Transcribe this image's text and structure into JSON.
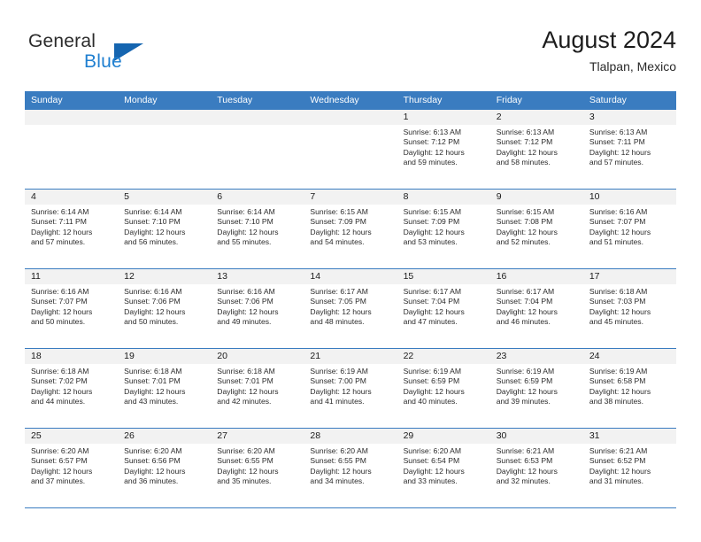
{
  "brand": {
    "name_part1": "General",
    "name_part2": "Blue",
    "flag_icon": "triangle-flag-icon",
    "accent_color": "#1f7fd0",
    "flag_color": "#1565b0"
  },
  "header": {
    "title": "August 2024",
    "subtitle": "Tlalpan, Mexico",
    "header_bg_color": "#3a7cc0",
    "date_strip_color": "#f2f2f2"
  },
  "weekdays": [
    "Sunday",
    "Monday",
    "Tuesday",
    "Wednesday",
    "Thursday",
    "Friday",
    "Saturday"
  ],
  "weeks": [
    [
      {
        "day": "",
        "sunrise": "",
        "sunset": "",
        "daylight_line1": "",
        "daylight_line2": "",
        "empty": true
      },
      {
        "day": "",
        "sunrise": "",
        "sunset": "",
        "daylight_line1": "",
        "daylight_line2": "",
        "empty": true
      },
      {
        "day": "",
        "sunrise": "",
        "sunset": "",
        "daylight_line1": "",
        "daylight_line2": "",
        "empty": true
      },
      {
        "day": "",
        "sunrise": "",
        "sunset": "",
        "daylight_line1": "",
        "daylight_line2": "",
        "empty": true
      },
      {
        "day": "1",
        "sunrise": "Sunrise: 6:13 AM",
        "sunset": "Sunset: 7:12 PM",
        "daylight_line1": "Daylight: 12 hours",
        "daylight_line2": "and 59 minutes."
      },
      {
        "day": "2",
        "sunrise": "Sunrise: 6:13 AM",
        "sunset": "Sunset: 7:12 PM",
        "daylight_line1": "Daylight: 12 hours",
        "daylight_line2": "and 58 minutes."
      },
      {
        "day": "3",
        "sunrise": "Sunrise: 6:13 AM",
        "sunset": "Sunset: 7:11 PM",
        "daylight_line1": "Daylight: 12 hours",
        "daylight_line2": "and 57 minutes."
      }
    ],
    [
      {
        "day": "4",
        "sunrise": "Sunrise: 6:14 AM",
        "sunset": "Sunset: 7:11 PM",
        "daylight_line1": "Daylight: 12 hours",
        "daylight_line2": "and 57 minutes."
      },
      {
        "day": "5",
        "sunrise": "Sunrise: 6:14 AM",
        "sunset": "Sunset: 7:10 PM",
        "daylight_line1": "Daylight: 12 hours",
        "daylight_line2": "and 56 minutes."
      },
      {
        "day": "6",
        "sunrise": "Sunrise: 6:14 AM",
        "sunset": "Sunset: 7:10 PM",
        "daylight_line1": "Daylight: 12 hours",
        "daylight_line2": "and 55 minutes."
      },
      {
        "day": "7",
        "sunrise": "Sunrise: 6:15 AM",
        "sunset": "Sunset: 7:09 PM",
        "daylight_line1": "Daylight: 12 hours",
        "daylight_line2": "and 54 minutes."
      },
      {
        "day": "8",
        "sunrise": "Sunrise: 6:15 AM",
        "sunset": "Sunset: 7:09 PM",
        "daylight_line1": "Daylight: 12 hours",
        "daylight_line2": "and 53 minutes."
      },
      {
        "day": "9",
        "sunrise": "Sunrise: 6:15 AM",
        "sunset": "Sunset: 7:08 PM",
        "daylight_line1": "Daylight: 12 hours",
        "daylight_line2": "and 52 minutes."
      },
      {
        "day": "10",
        "sunrise": "Sunrise: 6:16 AM",
        "sunset": "Sunset: 7:07 PM",
        "daylight_line1": "Daylight: 12 hours",
        "daylight_line2": "and 51 minutes."
      }
    ],
    [
      {
        "day": "11",
        "sunrise": "Sunrise: 6:16 AM",
        "sunset": "Sunset: 7:07 PM",
        "daylight_line1": "Daylight: 12 hours",
        "daylight_line2": "and 50 minutes."
      },
      {
        "day": "12",
        "sunrise": "Sunrise: 6:16 AM",
        "sunset": "Sunset: 7:06 PM",
        "daylight_line1": "Daylight: 12 hours",
        "daylight_line2": "and 50 minutes."
      },
      {
        "day": "13",
        "sunrise": "Sunrise: 6:16 AM",
        "sunset": "Sunset: 7:06 PM",
        "daylight_line1": "Daylight: 12 hours",
        "daylight_line2": "and 49 minutes."
      },
      {
        "day": "14",
        "sunrise": "Sunrise: 6:17 AM",
        "sunset": "Sunset: 7:05 PM",
        "daylight_line1": "Daylight: 12 hours",
        "daylight_line2": "and 48 minutes."
      },
      {
        "day": "15",
        "sunrise": "Sunrise: 6:17 AM",
        "sunset": "Sunset: 7:04 PM",
        "daylight_line1": "Daylight: 12 hours",
        "daylight_line2": "and 47 minutes."
      },
      {
        "day": "16",
        "sunrise": "Sunrise: 6:17 AM",
        "sunset": "Sunset: 7:04 PM",
        "daylight_line1": "Daylight: 12 hours",
        "daylight_line2": "and 46 minutes."
      },
      {
        "day": "17",
        "sunrise": "Sunrise: 6:18 AM",
        "sunset": "Sunset: 7:03 PM",
        "daylight_line1": "Daylight: 12 hours",
        "daylight_line2": "and 45 minutes."
      }
    ],
    [
      {
        "day": "18",
        "sunrise": "Sunrise: 6:18 AM",
        "sunset": "Sunset: 7:02 PM",
        "daylight_line1": "Daylight: 12 hours",
        "daylight_line2": "and 44 minutes."
      },
      {
        "day": "19",
        "sunrise": "Sunrise: 6:18 AM",
        "sunset": "Sunset: 7:01 PM",
        "daylight_line1": "Daylight: 12 hours",
        "daylight_line2": "and 43 minutes."
      },
      {
        "day": "20",
        "sunrise": "Sunrise: 6:18 AM",
        "sunset": "Sunset: 7:01 PM",
        "daylight_line1": "Daylight: 12 hours",
        "daylight_line2": "and 42 minutes."
      },
      {
        "day": "21",
        "sunrise": "Sunrise: 6:19 AM",
        "sunset": "Sunset: 7:00 PM",
        "daylight_line1": "Daylight: 12 hours",
        "daylight_line2": "and 41 minutes."
      },
      {
        "day": "22",
        "sunrise": "Sunrise: 6:19 AM",
        "sunset": "Sunset: 6:59 PM",
        "daylight_line1": "Daylight: 12 hours",
        "daylight_line2": "and 40 minutes."
      },
      {
        "day": "23",
        "sunrise": "Sunrise: 6:19 AM",
        "sunset": "Sunset: 6:59 PM",
        "daylight_line1": "Daylight: 12 hours",
        "daylight_line2": "and 39 minutes."
      },
      {
        "day": "24",
        "sunrise": "Sunrise: 6:19 AM",
        "sunset": "Sunset: 6:58 PM",
        "daylight_line1": "Daylight: 12 hours",
        "daylight_line2": "and 38 minutes."
      }
    ],
    [
      {
        "day": "25",
        "sunrise": "Sunrise: 6:20 AM",
        "sunset": "Sunset: 6:57 PM",
        "daylight_line1": "Daylight: 12 hours",
        "daylight_line2": "and 37 minutes."
      },
      {
        "day": "26",
        "sunrise": "Sunrise: 6:20 AM",
        "sunset": "Sunset: 6:56 PM",
        "daylight_line1": "Daylight: 12 hours",
        "daylight_line2": "and 36 minutes."
      },
      {
        "day": "27",
        "sunrise": "Sunrise: 6:20 AM",
        "sunset": "Sunset: 6:55 PM",
        "daylight_line1": "Daylight: 12 hours",
        "daylight_line2": "and 35 minutes."
      },
      {
        "day": "28",
        "sunrise": "Sunrise: 6:20 AM",
        "sunset": "Sunset: 6:55 PM",
        "daylight_line1": "Daylight: 12 hours",
        "daylight_line2": "and 34 minutes."
      },
      {
        "day": "29",
        "sunrise": "Sunrise: 6:20 AM",
        "sunset": "Sunset: 6:54 PM",
        "daylight_line1": "Daylight: 12 hours",
        "daylight_line2": "and 33 minutes."
      },
      {
        "day": "30",
        "sunrise": "Sunrise: 6:21 AM",
        "sunset": "Sunset: 6:53 PM",
        "daylight_line1": "Daylight: 12 hours",
        "daylight_line2": "and 32 minutes."
      },
      {
        "day": "31",
        "sunrise": "Sunrise: 6:21 AM",
        "sunset": "Sunset: 6:52 PM",
        "daylight_line1": "Daylight: 12 hours",
        "daylight_line2": "and 31 minutes."
      }
    ]
  ]
}
